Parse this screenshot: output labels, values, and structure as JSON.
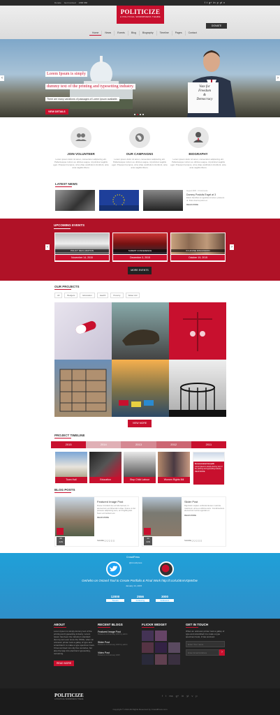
{
  "topbar": {
    "links": [
      "Donate",
      "Get Involved",
      "1888 888"
    ],
    "social": [
      "f",
      "t",
      "g+",
      "in",
      "p",
      "yt",
      "v"
    ]
  },
  "header": {
    "logo": "POLITICIZE",
    "tagline": "A POLITICAL WORDPRESS THEME",
    "donate": "DONATE",
    "nav": [
      "Home",
      "News",
      "Events",
      "Blog",
      "Biography",
      "Timeline",
      "Pages",
      "Contact"
    ]
  },
  "hero": {
    "line1": "Lorem Ipsum is simply",
    "line2": "dummy text of the printing and typesetting industry.",
    "sub": "There are many variations of passages of Lorem Ipsum available.",
    "button": "VIEW DETAILS",
    "sign": [
      "Vote for",
      "Freedom",
      "&",
      "Democracy"
    ]
  },
  "features": [
    {
      "title": "JOIN VOLUNTEER",
      "text": "Lorem ipsum dolor sit amet, consectetur adipiscing elit. Pellentesque rutrum eu ultrices augue, id pulvinar sagittis eget. Praesent tempus, urna vitae vestibulum tincidunt, ante ante sagittis libero."
    },
    {
      "title": "OUR CAMPAIGNS",
      "text": "Lorem ipsum dolor sit amet, consectetur adipiscing elit. Pellentesque rutrum eu ultrices augue, id pulvinar sagittis eget. Praesent tempus, urna vitae vestibulum tincidunt, ante ante sagittis libero."
    },
    {
      "title": "BIOGRAPHY",
      "text": "Lorem ipsum dolor sit amet, consectetur adipiscing elit. Pellentesque rutrum eu ultrices augue, id pulvinar sagittis eget. Praesent tempus, urna vitae vestibulum tincidunt, ante ante sagittis libero."
    }
  ],
  "news": {
    "title": "LATEST NEWS",
    "meta": "August 2015",
    "comments": "0 Comments",
    "headline": "Dummy Postulis Engel at 3",
    "text": "Etiam faucibus et egestas sit amet, posuere ut. Duis viverra purus et.",
    "more": "READ MORE"
  },
  "events": {
    "title": "UPCOMING EVENTS",
    "more": "MORE EVENTS",
    "items": [
      {
        "label": "POLICY DECLARATION",
        "date": "November 14, 2015"
      },
      {
        "label": "SUMMIT CONFERENCE",
        "date": "December 3, 2015"
      },
      {
        "label": "IN HOUSE DISCUSSION",
        "date": "October 19, 2015"
      }
    ]
  },
  "projects": {
    "title": "OUR PROJECTS",
    "filters": [
      "All",
      "Budgets",
      "Education",
      "Health",
      "Poverty",
      "Water Aid"
    ],
    "more": "VIEW MORE"
  },
  "timeline": {
    "title": "PROJECT TIMELINE",
    "years": [
      "2015",
      "2014",
      "2013",
      "2012",
      "2011"
    ],
    "items": [
      "Town Hall",
      "Education",
      "Stop Child Labour",
      "Women Rights Bill"
    ],
    "feature": {
      "title": "Economical Growth",
      "text": "Lorem Ipsum is simply dummy text of the printing and typesetting industry.",
      "more": "READ MORE"
    }
  },
  "blog": {
    "title": "BLOG POSTS",
    "posts": [
      {
        "title": "Featured Image Post",
        "day": "25",
        "month": "JUN",
        "text": "Donec tincidunt leo at felis laoreet, in elementum est bibendum vitae. Fusce ut dui posuere adipiscing sem, ac fringilla justo. Nunc at tincidunt est.",
        "more": "READ MORE",
        "share": "SHARE"
      },
      {
        "title": "Slider Post",
        "day": "23",
        "month": "JUN",
        "text": "Dignissim sapien vehicula laoreet. Lacinia maximum urna eu ultrices arcu. Condimentum elementum lectus egestas et.",
        "more": "READ MORE",
        "share": "SHARE"
      }
    ]
  },
  "twitter": {
    "handle": "CrowdPress",
    "user": "@crowdpress",
    "tweet": "Get/who on Ostand Tool to Create Portfolio & Final Work http://t.co/Ud4nsV0pWDw",
    "date": "January 14, 2015",
    "stats": [
      {
        "n": "12000",
        "l": "Tweets"
      },
      {
        "n": "2556",
        "l": "Following"
      },
      {
        "n": "3000",
        "l": "Followers"
      }
    ]
  },
  "footer": {
    "about": {
      "title": "ABOUT",
      "text": "Lorem Ipsum is simply dummy text of the printing and typesetting industry. Lorem Ipsum has been the industry's standard dummy text ever since the 1500s, when an unknown printer took a galley of type and scrambled it to make a type specimen book. It has survived not only five centuries, but also the leap into electronic typesetting, remaining.",
      "more": "READ MORE"
    },
    "blogs": {
      "title": "RECENT BLOGS",
      "items": [
        {
          "t": "Featured Image Post",
          "d": "Posted on 14 February 2015 by admin"
        },
        {
          "t": "Slider Post",
          "d": "Posted on 14 February 2015 by admin"
        },
        {
          "t": "Video Post",
          "d": "Posted on 14 February 2015"
        }
      ]
    },
    "flickr": {
      "title": "FLICKR WIDGET"
    },
    "contact": {
      "title": "GET IN TOUCH",
      "text": "When an unknown printer took a galley of type and scrambled it to make a type specimen book, it has survived.",
      "name_ph": "Enter Your name",
      "email_ph": "Enter Email Address"
    }
  },
  "bottom": {
    "logo": "POLITICIZE",
    "tagline": "A POLITICAL WORDPRESS THEME",
    "copy": "Copyright © 2014 All Rights Reserved by CrowdPress.com",
    "social": [
      "f",
      "t",
      "rss",
      "g+",
      "in",
      "yt",
      "v",
      "p"
    ]
  }
}
